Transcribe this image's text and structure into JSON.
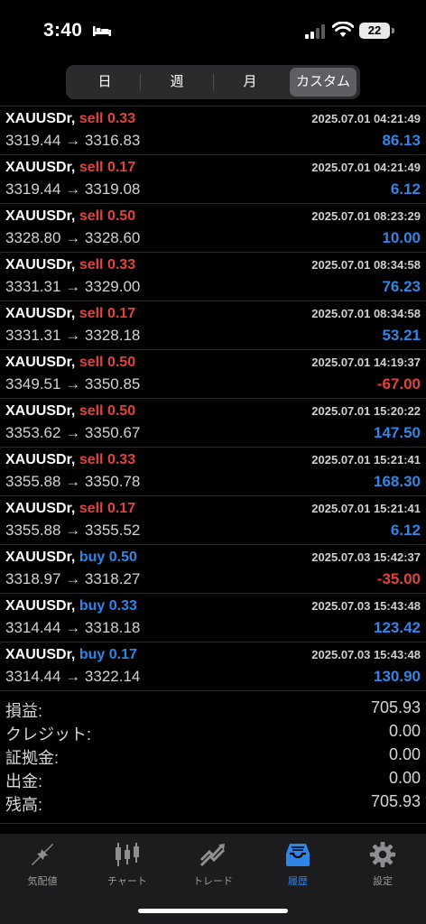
{
  "status_bar": {
    "time": "3:40",
    "battery": "22"
  },
  "period_tabs": [
    {
      "label": "日",
      "active": false
    },
    {
      "label": "週",
      "active": false
    },
    {
      "label": "月",
      "active": false
    },
    {
      "label": "カスタム",
      "active": true
    }
  ],
  "deals": [
    {
      "symbol": "XAUUSDr,",
      "side": "sell",
      "volume": "0.33",
      "datetime": "2025.07.01 04:21:49",
      "open_price": "3319.44",
      "arrow": "→",
      "close_price": "3316.83",
      "profit": "86.13",
      "profit_sign": "pos"
    },
    {
      "symbol": "XAUUSDr,",
      "side": "sell",
      "volume": "0.17",
      "datetime": "2025.07.01 04:21:49",
      "open_price": "3319.44",
      "arrow": "→",
      "close_price": "3319.08",
      "profit": "6.12",
      "profit_sign": "pos"
    },
    {
      "symbol": "XAUUSDr,",
      "side": "sell",
      "volume": "0.50",
      "datetime": "2025.07.01 08:23:29",
      "open_price": "3328.80",
      "arrow": "→",
      "close_price": "3328.60",
      "profit": "10.00",
      "profit_sign": "pos"
    },
    {
      "symbol": "XAUUSDr,",
      "side": "sell",
      "volume": "0.33",
      "datetime": "2025.07.01 08:34:58",
      "open_price": "3331.31",
      "arrow": "→",
      "close_price": "3329.00",
      "profit": "76.23",
      "profit_sign": "pos"
    },
    {
      "symbol": "XAUUSDr,",
      "side": "sell",
      "volume": "0.17",
      "datetime": "2025.07.01 08:34:58",
      "open_price": "3331.31",
      "arrow": "→",
      "close_price": "3328.18",
      "profit": "53.21",
      "profit_sign": "pos"
    },
    {
      "symbol": "XAUUSDr,",
      "side": "sell",
      "volume": "0.50",
      "datetime": "2025.07.01 14:19:37",
      "open_price": "3349.51",
      "arrow": "→",
      "close_price": "3350.85",
      "profit": "-67.00",
      "profit_sign": "neg"
    },
    {
      "symbol": "XAUUSDr,",
      "side": "sell",
      "volume": "0.50",
      "datetime": "2025.07.01 15:20:22",
      "open_price": "3353.62",
      "arrow": "→",
      "close_price": "3350.67",
      "profit": "147.50",
      "profit_sign": "pos"
    },
    {
      "symbol": "XAUUSDr,",
      "side": "sell",
      "volume": "0.33",
      "datetime": "2025.07.01 15:21:41",
      "open_price": "3355.88",
      "arrow": "→",
      "close_price": "3350.78",
      "profit": "168.30",
      "profit_sign": "pos"
    },
    {
      "symbol": "XAUUSDr,",
      "side": "sell",
      "volume": "0.17",
      "datetime": "2025.07.01 15:21:41",
      "open_price": "3355.88",
      "arrow": "→",
      "close_price": "3355.52",
      "profit": "6.12",
      "profit_sign": "pos"
    },
    {
      "symbol": "XAUUSDr,",
      "side": "buy",
      "volume": "0.50",
      "datetime": "2025.07.03 15:42:37",
      "open_price": "3318.97",
      "arrow": "→",
      "close_price": "3318.27",
      "profit": "-35.00",
      "profit_sign": "neg"
    },
    {
      "symbol": "XAUUSDr,",
      "side": "buy",
      "volume": "0.33",
      "datetime": "2025.07.03 15:43:48",
      "open_price": "3314.44",
      "arrow": "→",
      "close_price": "3318.18",
      "profit": "123.42",
      "profit_sign": "pos"
    },
    {
      "symbol": "XAUUSDr,",
      "side": "buy",
      "volume": "0.17",
      "datetime": "2025.07.03 15:43:48",
      "open_price": "3314.44",
      "arrow": "→",
      "close_price": "3322.14",
      "profit": "130.90",
      "profit_sign": "pos"
    }
  ],
  "summary": [
    {
      "label": "損益:",
      "value": "705.93"
    },
    {
      "label": "クレジット:",
      "value": "0.00"
    },
    {
      "label": "証拠金:",
      "value": "0.00"
    },
    {
      "label": "出金:",
      "value": "0.00"
    },
    {
      "label": "残高:",
      "value": "705.93"
    }
  ],
  "tabbar": [
    {
      "label": "気配値",
      "icon": "quotes-icon",
      "active": false
    },
    {
      "label": "チャート",
      "icon": "chart-icon",
      "active": false
    },
    {
      "label": "トレード",
      "icon": "trade-icon",
      "active": false
    },
    {
      "label": "履歴",
      "icon": "history-icon",
      "active": true
    },
    {
      "label": "設定",
      "icon": "gear-icon",
      "active": false
    }
  ],
  "colors": {
    "sell": "#e5423a",
    "buy": "#2f86e8",
    "profit_pos": "#2f86e8",
    "profit_neg": "#e5423a",
    "active_tab": "#2f86e8"
  }
}
